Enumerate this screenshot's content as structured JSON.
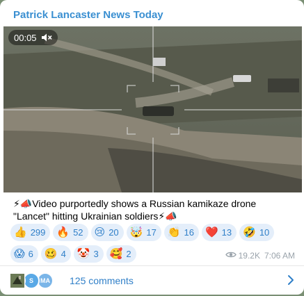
{
  "post": {
    "channel_name": "Patrick Lancaster News Today",
    "video": {
      "duration": "00:05",
      "muted_icon": "speaker-muted-icon"
    },
    "caption_line1": "⚡📣Video purportedly shows  a Russian kamikaze drone",
    "caption_line2": "\"Lancet\" hitting Ukrainian soldiers⚡📣",
    "reactions": [
      {
        "emoji": "👍",
        "count": "299"
      },
      {
        "emoji": "🔥",
        "count": "52"
      },
      {
        "emoji": "😢",
        "count": "20"
      },
      {
        "emoji": "🤯",
        "count": "17"
      },
      {
        "emoji": "👏",
        "count": "16"
      },
      {
        "emoji": "❤️",
        "count": "13"
      },
      {
        "emoji": "🤣",
        "count": "10"
      },
      {
        "emoji": "😱",
        "count": "6"
      },
      {
        "emoji": "🥴",
        "count": "4"
      },
      {
        "emoji": "🤡",
        "count": "3"
      },
      {
        "emoji": "🥰",
        "count": "2"
      }
    ],
    "views": "19.2K",
    "time": "7:06 AM",
    "comments": {
      "avatars": [
        "",
        "S",
        "MA"
      ],
      "label": "125 comments"
    }
  },
  "colors": {
    "channel_name": "#3a8fd1",
    "link_blue": "#2f7fc8",
    "reaction_bg": "#e4eefa",
    "meta_gray": "#9aa3ab"
  }
}
